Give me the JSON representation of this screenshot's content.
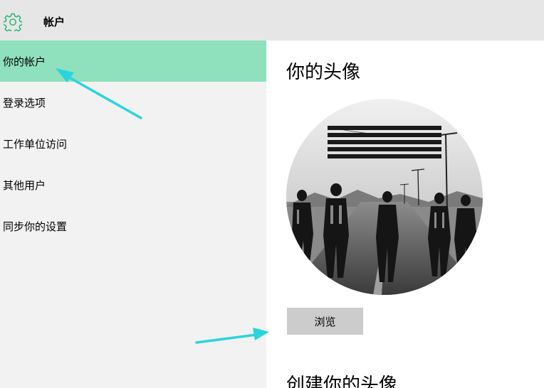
{
  "header": {
    "title": "帐户",
    "icon": "gear-icon",
    "accent_color": "#1fb36c"
  },
  "sidebar": {
    "items": [
      {
        "label": "你的帐户",
        "selected": true
      },
      {
        "label": "登录选项",
        "selected": false
      },
      {
        "label": "工作单位访问",
        "selected": false
      },
      {
        "label": "其他用户",
        "selected": false
      },
      {
        "label": "同步你的设置",
        "selected": false
      }
    ],
    "selected_color": "#8fe0bd"
  },
  "main": {
    "avatar_heading": "你的头像",
    "browse_label": "浏览",
    "create_heading": "创建你的头像"
  },
  "annotations": {
    "arrow_color": "#2ad4de"
  }
}
